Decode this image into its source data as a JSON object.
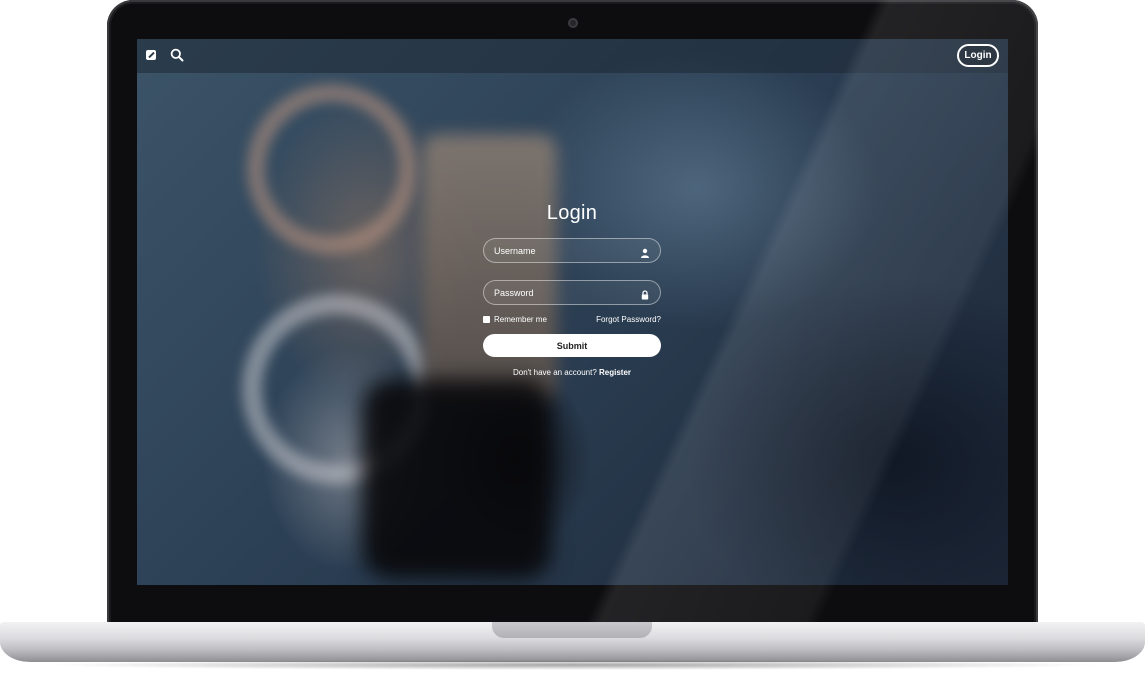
{
  "navbar": {
    "brand_icon": "edit-square-icon",
    "search_icon": "search-icon",
    "login_label": "Login"
  },
  "form": {
    "title": "Login",
    "username_placeholder": "Username",
    "username_icon": "user-icon",
    "password_placeholder": "Password",
    "password_icon": "lock-icon",
    "remember_label": "Remember me",
    "forgot_label": "Forgot Password?",
    "submit_label": "Submit",
    "register_prompt": "Don't have an account?",
    "register_label": "Register"
  },
  "colors": {
    "text": "#ffffff",
    "button_bg": "#ffffff",
    "button_text": "#222222",
    "laptop_bezel": "#0d0d0f",
    "laptop_base": "#dcdcdf"
  }
}
